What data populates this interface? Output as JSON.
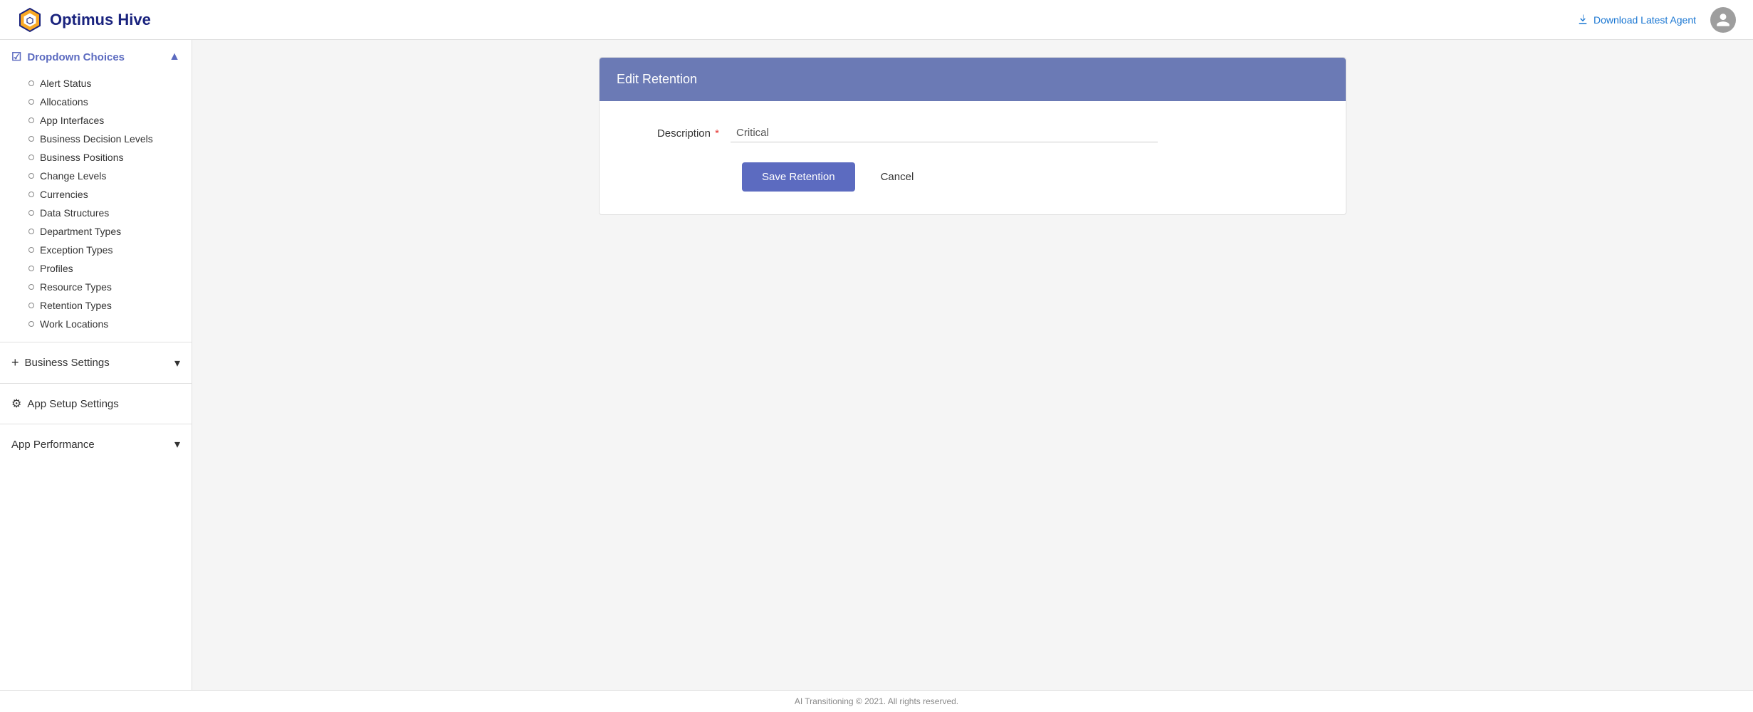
{
  "header": {
    "logo_text": "Optimus Hive",
    "download_label": "Download Latest Agent",
    "avatar_icon": "person"
  },
  "sidebar": {
    "sections": [
      {
        "id": "dropdown-choices",
        "icon": "checkbox",
        "label": "Dropdown Choices",
        "expanded": true,
        "chevron": "▲",
        "items": [
          "Alert Status",
          "Allocations",
          "App Interfaces",
          "Business Decision Levels",
          "Business Positions",
          "Change Levels",
          "Currencies",
          "Data Structures",
          "Department Types",
          "Exception Types",
          "Profiles",
          "Resource Types",
          "Retention Types",
          "Work Locations"
        ]
      },
      {
        "id": "business-settings",
        "icon": "+",
        "label": "Business Settings",
        "expanded": false,
        "chevron": "▾"
      },
      {
        "id": "app-setup-settings",
        "icon": "⚙",
        "label": "App Setup Settings",
        "expanded": false,
        "chevron": ""
      },
      {
        "id": "app-performance",
        "icon": "",
        "label": "App Performance",
        "expanded": false,
        "chevron": "▾"
      }
    ]
  },
  "main": {
    "panel_title": "Edit Retention",
    "form": {
      "description_label": "Description",
      "description_required": true,
      "description_value": "Critical",
      "save_button": "Save Retention",
      "cancel_button": "Cancel"
    }
  },
  "footer": {
    "text": "AI Transitioning © 2021. All rights reserved."
  }
}
